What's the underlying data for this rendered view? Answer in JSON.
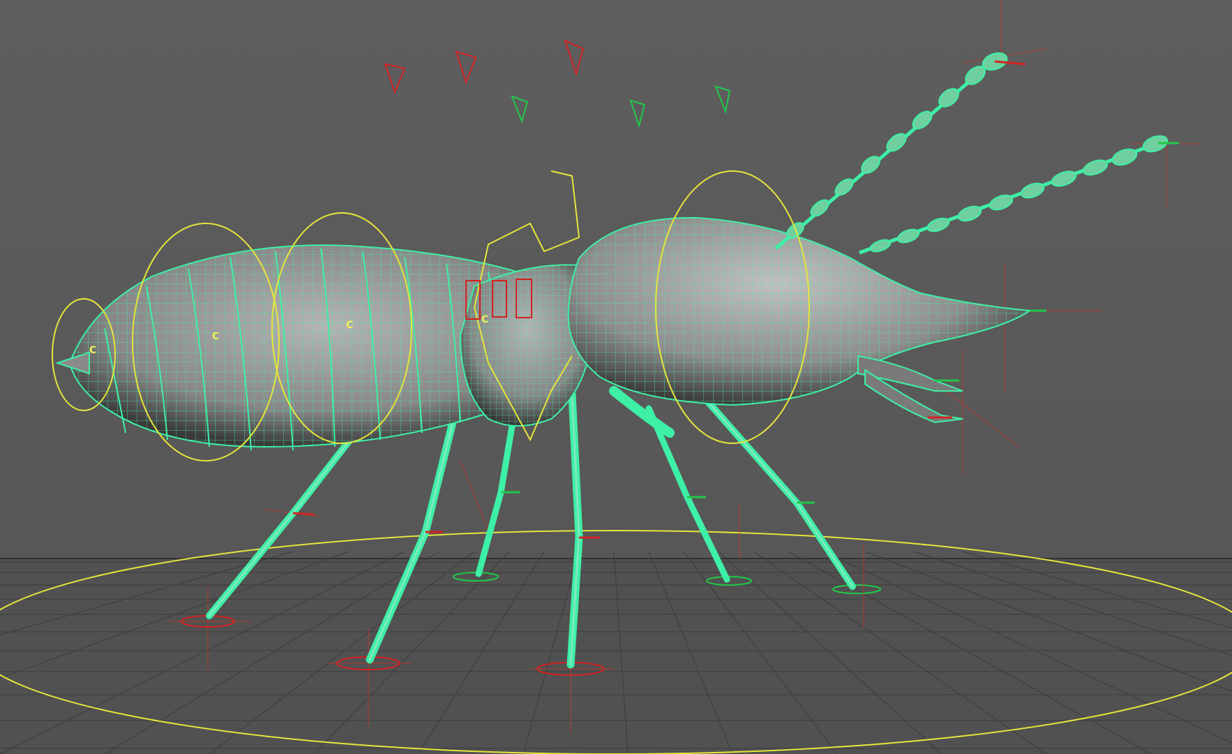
{
  "viewport": {
    "name": "perspective-viewport",
    "background": "#575757"
  },
  "colors": {
    "wireframe": "#3ef0a6",
    "mesh_shade": "#8c8c8c",
    "controller": "#e6e63c",
    "locator_red": "#d22222",
    "locator_green": "#22c84a",
    "grid": "#3e3e3e",
    "grid_floor": "#4a4a4a"
  },
  "controls": {
    "labels": [
      "C",
      "C",
      "C",
      "C"
    ]
  },
  "icons": [
    "camera-triangle-icon",
    "ik-handle-icon",
    "locator-icon",
    "nurbs-circle-icon"
  ]
}
